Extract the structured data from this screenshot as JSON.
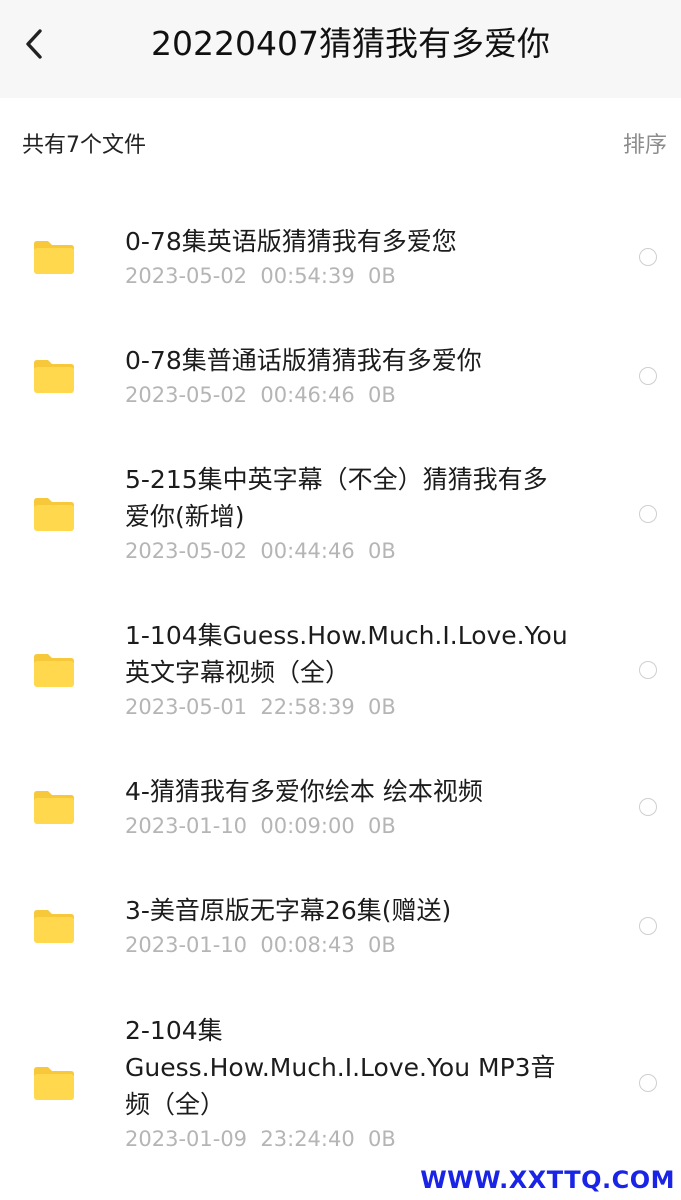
{
  "header": {
    "title": "20220407猜猜我有多爱你",
    "back_icon": "chevron-left-icon"
  },
  "toolbar": {
    "count_label": "共有7个文件",
    "sort_label": "排序"
  },
  "colors": {
    "folder": "#FFD84D",
    "folder_tab": "#F7C93A",
    "meta_text": "#B5B5B5",
    "watermark": "#1A24E6"
  },
  "files": [
    {
      "name": "0-78集英语版猜猜我有多爱您",
      "meta": "2023-05-02  00:54:39  0B",
      "icon": "folder-icon"
    },
    {
      "name": "0-78集普通话版猜猜我有多爱你",
      "meta": "2023-05-02  00:46:46  0B",
      "icon": "folder-icon"
    },
    {
      "name": "5-215集中英字幕（不全）猜猜我有多爱你(新增)",
      "meta": "2023-05-02  00:44:46  0B",
      "icon": "folder-icon"
    },
    {
      "name": "1-104集Guess.How.Much.I.Love.You英文字幕视频（全）",
      "meta": "2023-05-01  22:58:39  0B",
      "icon": "folder-icon"
    },
    {
      "name": "4-猜猜我有多爱你绘本 绘本视频",
      "meta": "2023-01-10  00:09:00  0B",
      "icon": "folder-icon"
    },
    {
      "name": "3-美音原版无字幕26集(赠送)",
      "meta": "2023-01-10  00:08:43  0B",
      "icon": "folder-icon"
    },
    {
      "name": "2-104集Guess.How.Much.I.Love.You MP3音频（全）",
      "meta": "2023-01-09  23:24:40  0B",
      "icon": "folder-icon"
    }
  ],
  "watermark": "WWW.XXTTQ.COM"
}
